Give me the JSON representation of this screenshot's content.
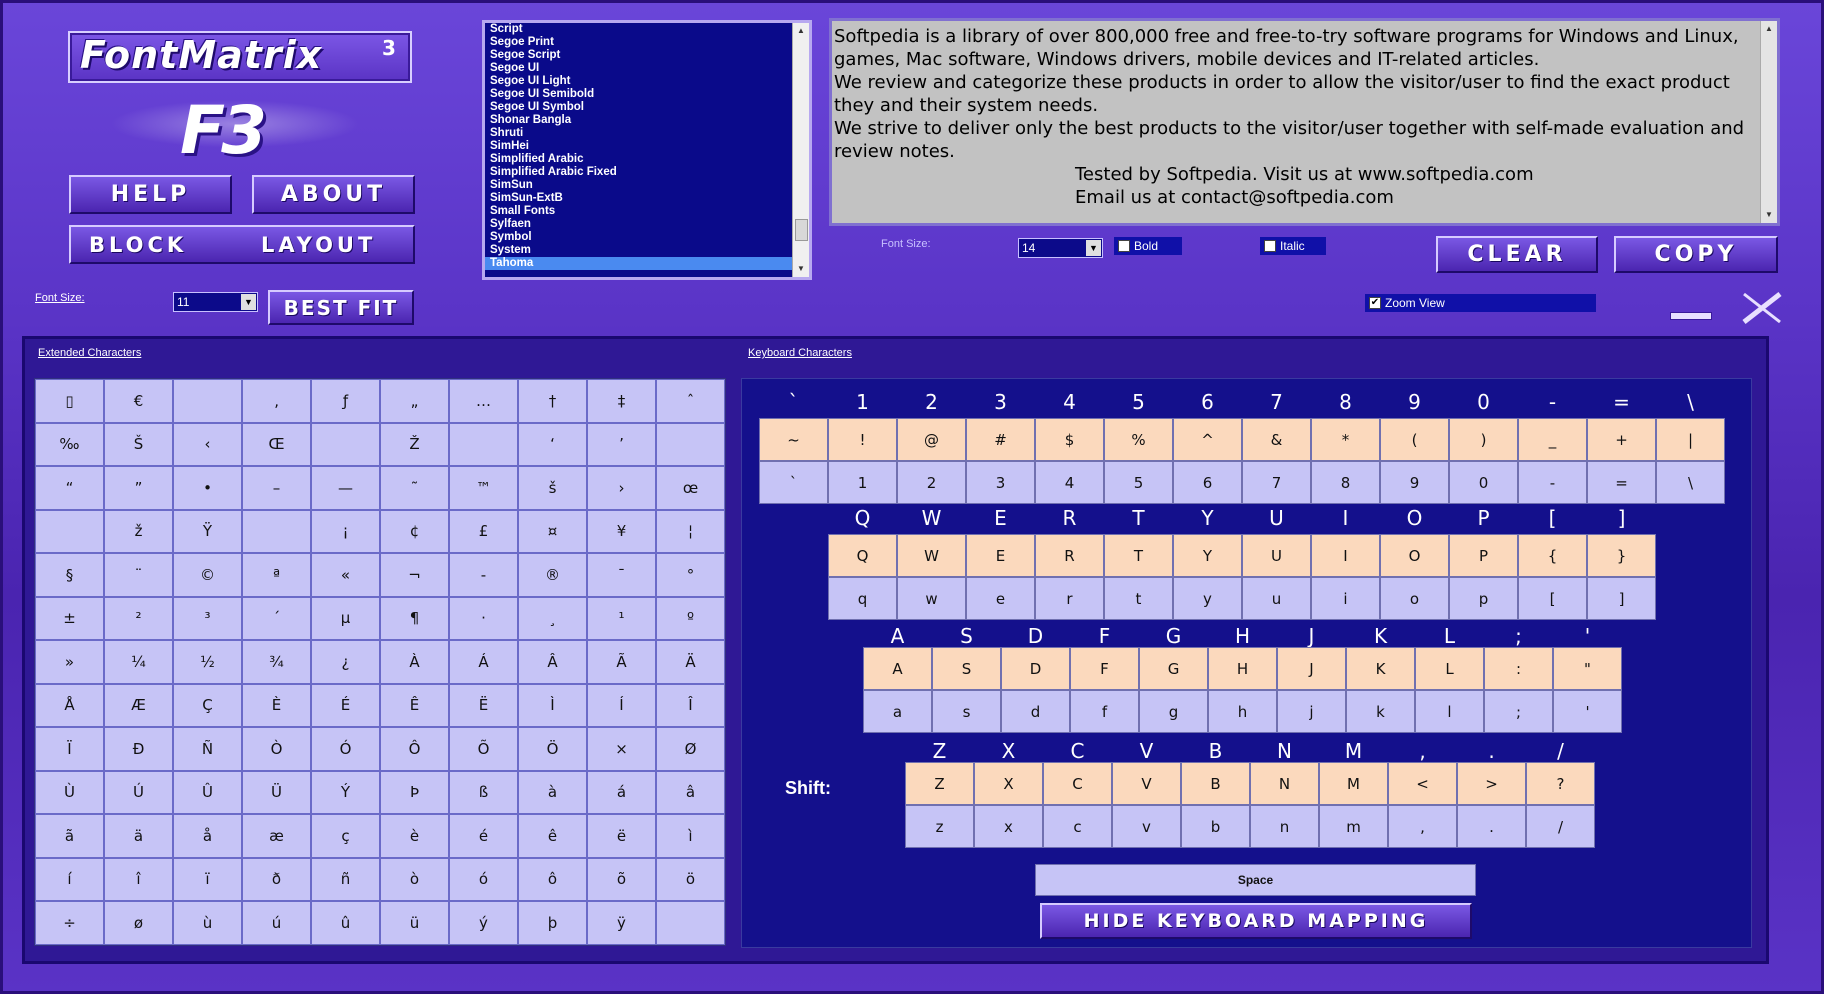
{
  "app": {
    "logo": "FontMatrix",
    "logo_sup": "3",
    "logo_mark": "F3"
  },
  "buttons": {
    "help": "HELP",
    "about": "ABOUT",
    "block": "BLOCK",
    "layout": "LAYOUT",
    "best_fit": "BEST FIT",
    "clear": "CLEAR",
    "copy": "COPY",
    "hide_kb": "HIDE KEYBOARD MAPPING"
  },
  "font_size_left": {
    "label": "Font Size:",
    "value": "11"
  },
  "font_list": {
    "items": [
      "Script",
      "Segoe Print",
      "Segoe Script",
      "Segoe UI",
      "Segoe UI Light",
      "Segoe UI Semibold",
      "Segoe UI Symbol",
      "Shonar Bangla",
      "Shruti",
      "SimHei",
      "Simplified Arabic",
      "Simplified Arabic Fixed",
      "SimSun",
      "SimSun-ExtB",
      "Small Fonts",
      "Sylfaen",
      "Symbol",
      "System",
      "Tahoma"
    ],
    "selected": "Tahoma"
  },
  "preview": {
    "lines": [
      "Softpedia is a library of over 800,000 free and free-to-try software programs for Windows and Linux, games, Mac software, Windows drivers, mobile devices and IT-related articles.",
      "We review and categorize these products in order to allow the visitor/user to find the exact product they and their system needs.",
      "We strive to deliver only the best products to the visitor/user together with self-made evaluation and review notes."
    ],
    "center_lines": [
      "Tested by Softpedia. Visit us at www.softpedia.com",
      "Email us at contact@softpedia.com"
    ]
  },
  "options": {
    "font_size_label": "Font Size:",
    "font_size_value": "14",
    "bold_label": "Bold",
    "italic_label": "Italic",
    "zoom_label": "Zoom View",
    "zoom_checked": "✔"
  },
  "extended": {
    "label": "Extended Characters",
    "cells": [
      "▯",
      "€",
      "",
      "‚",
      "ƒ",
      "„",
      "…",
      "†",
      "‡",
      "ˆ",
      "‰",
      "Š",
      "‹",
      "Œ",
      "",
      "Ž",
      "",
      "‘",
      "’",
      "",
      "“",
      "”",
      "•",
      "–",
      "—",
      "˜",
      "™",
      "š",
      "›",
      "œ",
      "",
      "ž",
      "Ÿ",
      "",
      "¡",
      "¢",
      "£",
      "¤",
      "¥",
      "¦",
      "§",
      "¨",
      "©",
      "ª",
      "«",
      "¬",
      "-",
      "®",
      "¯",
      "°",
      "±",
      "²",
      "³",
      "´",
      "µ",
      "¶",
      "·",
      "¸",
      "¹",
      "º",
      "»",
      "¼",
      "½",
      "¾",
      "¿",
      "À",
      "Á",
      "Â",
      "Ã",
      "Ä",
      "Å",
      "Æ",
      "Ç",
      "È",
      "É",
      "Ê",
      "Ë",
      "Ì",
      "Í",
      "Î",
      "Ï",
      "Ð",
      "Ñ",
      "Ò",
      "Ó",
      "Ô",
      "Õ",
      "Ö",
      "×",
      "Ø",
      "Ù",
      "Ú",
      "Û",
      "Ü",
      "Ý",
      "Þ",
      "ß",
      "à",
      "á",
      "â",
      "ã",
      "ä",
      "å",
      "æ",
      "ç",
      "è",
      "é",
      "ê",
      "ë",
      "ì",
      "í",
      "î",
      "ï",
      "ð",
      "ñ",
      "ò",
      "ó",
      "ô",
      "õ",
      "ö",
      "÷",
      "ø",
      "ù",
      "ú",
      "û",
      "ü",
      "ý",
      "þ",
      "ÿ",
      ""
    ]
  },
  "keyboard": {
    "label": "Keyboard Characters",
    "shift_label": "Shift:",
    "space_label": "Space",
    "row1_head": [
      "`",
      "1",
      "2",
      "3",
      "4",
      "5",
      "6",
      "7",
      "8",
      "9",
      "0",
      "-",
      "=",
      "\\"
    ],
    "row1_up": [
      "~",
      "!",
      "@",
      "#",
      "$",
      "%",
      "^",
      "&",
      "*",
      "(",
      ")",
      "_",
      "+",
      "|"
    ],
    "row1_lo": [
      "`",
      "1",
      "2",
      "3",
      "4",
      "5",
      "6",
      "7",
      "8",
      "9",
      "0",
      "-",
      "=",
      "\\"
    ],
    "row2_head": [
      "Q",
      "W",
      "E",
      "R",
      "T",
      "Y",
      "U",
      "I",
      "O",
      "P",
      "[",
      "]"
    ],
    "row2_up": [
      "Q",
      "W",
      "E",
      "R",
      "T",
      "Y",
      "U",
      "I",
      "O",
      "P",
      "{",
      "}"
    ],
    "row2_lo": [
      "q",
      "w",
      "e",
      "r",
      "t",
      "y",
      "u",
      "i",
      "o",
      "p",
      "[",
      "]"
    ],
    "row3_head": [
      "A",
      "S",
      "D",
      "F",
      "G",
      "H",
      "J",
      "K",
      "L",
      ";",
      "'"
    ],
    "row3_up": [
      "A",
      "S",
      "D",
      "F",
      "G",
      "H",
      "J",
      "K",
      "L",
      ":",
      "\""
    ],
    "row3_lo": [
      "a",
      "s",
      "d",
      "f",
      "g",
      "h",
      "j",
      "k",
      "l",
      ";",
      "'"
    ],
    "row4_head": [
      "Z",
      "X",
      "C",
      "V",
      "B",
      "N",
      "M",
      ",",
      ".",
      "/"
    ],
    "row4_up": [
      "Z",
      "X",
      "C",
      "V",
      "B",
      "N",
      "M",
      "<",
      ">",
      "?"
    ],
    "row4_lo": [
      "z",
      "x",
      "c",
      "v",
      "b",
      "n",
      "m",
      ",",
      ".",
      "/"
    ]
  }
}
